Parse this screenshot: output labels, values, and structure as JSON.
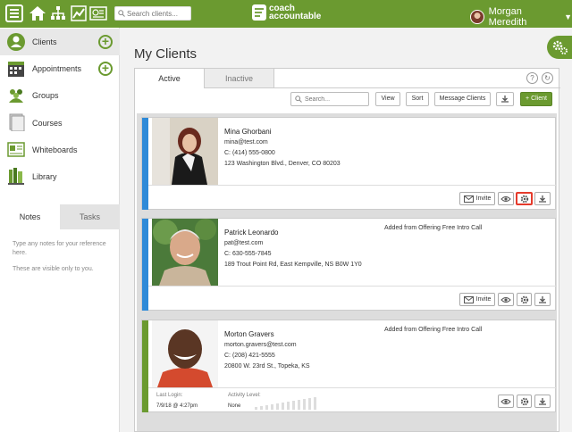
{
  "header": {
    "search_placeholder": "Search clients...",
    "logo_line1": "coach",
    "logo_line2": "accountable",
    "user_name": "Morgan Meredith"
  },
  "sidebar": {
    "items": [
      {
        "label": "Clients"
      },
      {
        "label": "Appointments"
      },
      {
        "label": "Groups"
      },
      {
        "label": "Courses"
      },
      {
        "label": "Whiteboards"
      },
      {
        "label": "Library"
      }
    ],
    "tabs": {
      "notes": "Notes",
      "tasks": "Tasks"
    },
    "notes_line1": "Type any notes for your reference here.",
    "notes_line2": "These are visible only to you."
  },
  "main": {
    "title": "My Clients",
    "tabs": {
      "active": "Active",
      "inactive": "Inactive"
    },
    "toolbar": {
      "search_placeholder": "Search...",
      "view": "View",
      "sort": "Sort",
      "message": "Message Clients",
      "add": "+ Client"
    },
    "clients": [
      {
        "name": "Mina Ghorbani",
        "email": "mina@test.com",
        "phone": "C: (414) 555-0800",
        "address": "123 Washington Blvd., Denver, CO 80203",
        "note": "",
        "invite": "Invite"
      },
      {
        "name": "Patrick Leonardo",
        "email": "pat@test.com",
        "phone": "C: 630-555-7845",
        "address": "189 Trout Point Rd, East Kempville, NS B0W 1Y0",
        "note": "Added from Offering Free Intro Call",
        "invite": "Invite"
      },
      {
        "name": "Morton Gravers",
        "email": "morton.gravers@test.com",
        "phone": "C: (208) 421-5555",
        "address": "20800 W. 23rd St., Topeka, KS",
        "note": "Added from Offering Free Intro Call",
        "last_login_label": "Last Login:",
        "last_login": "7/9/18 @ 4:27pm",
        "activity_label": "Activity Level:",
        "activity": "None"
      }
    ]
  },
  "colors": {
    "green": "#6b9a30",
    "blue_stripe": "#2e8ad8",
    "green_stripe": "#6b9a30",
    "highlight": "#e53b2c"
  }
}
